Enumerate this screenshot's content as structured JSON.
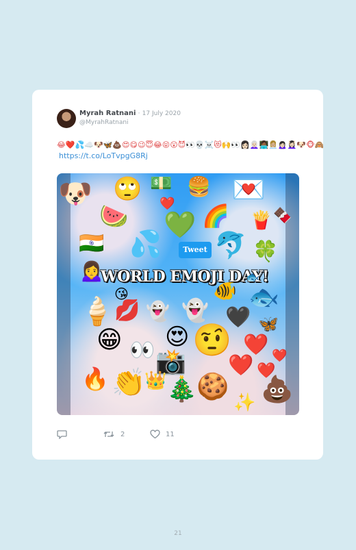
{
  "tweet": {
    "author_name": "Myrah Ratnani",
    "separator": "·",
    "date": "17 July 2020",
    "handle": "@MyrahRatnani",
    "emoji_text": "😂❤️💦☁️🐶🦋💩😍😋😉😇😂😝😲😈👀💀☠️😻🙌👀👩🏻👩🏻‍🦳👩🏾‍💻👩🏼‍💼🙍🏻‍♀️💆🏻‍♀️🐶🐵🙈🐵🙊",
    "link": "https://t.co/LoTvpgG8Rj"
  },
  "media": {
    "headline": "WORLD EMOJI DAY!",
    "tweet_badge": "Tweet",
    "emojis": [
      "🐶",
      "🙄",
      "💵",
      "🍔",
      "💌",
      "❤️",
      "🍉",
      "💚",
      "🌈",
      "🍟",
      "🍫",
      "🇮🇳",
      "💦",
      "🐬",
      "🍀",
      "🙍‍♀️",
      "🐟",
      "🐠",
      "💋",
      "😘",
      "👻",
      "🖤",
      "🍦",
      "🦋",
      "😁",
      "👀",
      "😍",
      "🤨",
      "❤️",
      "❤️",
      "❤️",
      "❤️",
      "📸",
      "🔥",
      "👏",
      "👑",
      "🎄",
      "🍪",
      "💩",
      "✨"
    ]
  },
  "actions": {
    "reply_count": "",
    "retweet_count": "2",
    "like_count": "11"
  },
  "footer": {
    "page_number": "21"
  }
}
